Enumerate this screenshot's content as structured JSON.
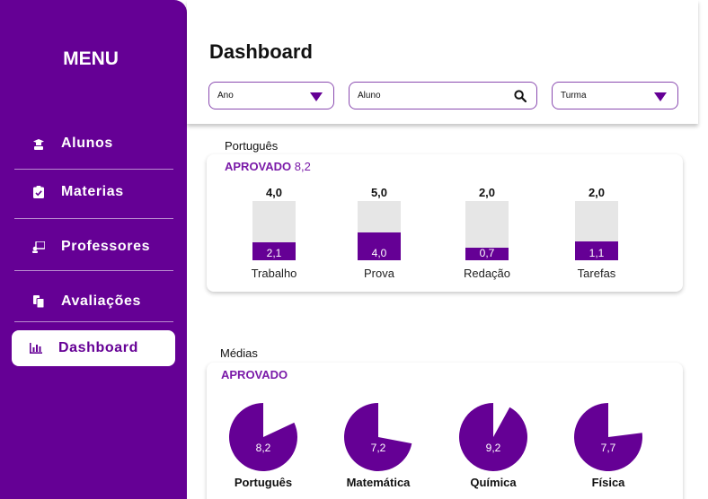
{
  "sidebar": {
    "title": "MENU",
    "items": [
      {
        "label": "Alunos",
        "icon": "student-icon"
      },
      {
        "label": "Materias",
        "icon": "clipboard-check-icon"
      },
      {
        "label": "Professores",
        "icon": "teacher-icon"
      },
      {
        "label": "Avaliações",
        "icon": "documents-icon"
      },
      {
        "label": "Dashboard",
        "icon": "bar-chart-icon",
        "active": true
      }
    ]
  },
  "header": {
    "title": "Dashboard",
    "filters": {
      "ano": {
        "value": "Ano",
        "icon": "dropdown-triangle-icon"
      },
      "aluno": {
        "value": "Aluno",
        "icon": "search-icon"
      },
      "turma": {
        "value": "Turma",
        "icon": "dropdown-triangle-icon"
      }
    }
  },
  "colors": {
    "primary": "#650095",
    "bar_background": "#e6e6e6",
    "status": "#7a1aa8"
  },
  "portugues": {
    "section_label": "Português",
    "status": "APROVADO",
    "score": "8,2",
    "chart_data": {
      "type": "bar",
      "categories": [
        "Trabalho",
        "Prova",
        "Redação",
        "Tarefas"
      ],
      "totals": [
        4.0,
        5.0,
        2.0,
        2.0
      ],
      "values": [
        2.1,
        4.0,
        0.7,
        1.1
      ],
      "total_labels": [
        "4,0",
        "5,0",
        "2,0",
        "2,0"
      ],
      "value_labels": [
        "2,1",
        "4,0",
        "0,7",
        "1,1"
      ]
    }
  },
  "medias": {
    "section_label": "Médias",
    "status": "APROVADO",
    "chart_data": {
      "type": "pie",
      "categories": [
        "Português",
        "Matemática",
        "Química",
        "Física"
      ],
      "values": [
        8.2,
        7.2,
        9.2,
        7.7
      ],
      "max": 10,
      "value_labels": [
        "8,2",
        "7,2",
        "9,2",
        "7,7"
      ]
    }
  }
}
